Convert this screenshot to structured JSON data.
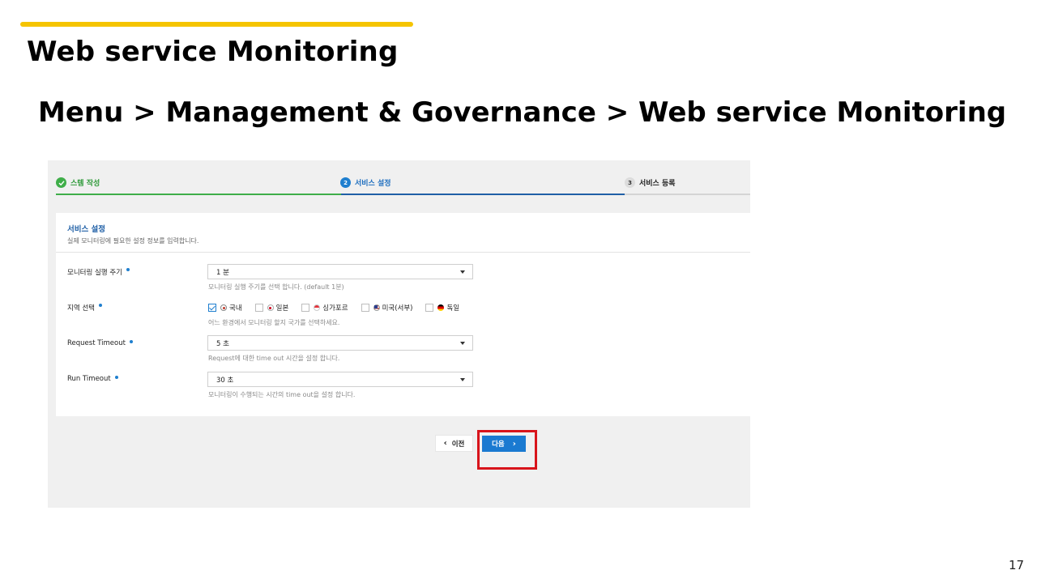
{
  "slide": {
    "title": "Web service Monitoring",
    "breadcrumb": "Menu  >  Management & Governance  >  Web service Monitoring",
    "page_number": "17",
    "accent_color": "#f5c400"
  },
  "stepper": {
    "steps": [
      {
        "number": "",
        "label": "스템 작성",
        "state": "done",
        "icon": "check-icon"
      },
      {
        "number": "2",
        "label": "서비스 설정",
        "state": "active"
      },
      {
        "number": "3",
        "label": "서비스 등록",
        "state": "todo"
      }
    ]
  },
  "form": {
    "title": "서비스 설정",
    "description": "실제 모니터링에 필요한 설정 정보를 입력합니다.",
    "fields": {
      "interval": {
        "label": "모니터링 실행 주기",
        "value": "1 분",
        "hint": "모니터링 실행 주기를 선택 합니다. (default 1분)"
      },
      "region": {
        "label": "지역 선택",
        "hint": "어느 환경에서 모니터링 할지 국가를 선택하세요.",
        "options": [
          {
            "label": "국내",
            "checked": true,
            "flag": "flag-korea-icon"
          },
          {
            "label": "일본",
            "checked": false,
            "flag": "flag-japan-icon"
          },
          {
            "label": "싱가포르",
            "checked": false,
            "flag": "flag-singapore-icon"
          },
          {
            "label": "미국(서부)",
            "checked": false,
            "flag": "flag-usa-icon"
          },
          {
            "label": "독일",
            "checked": false,
            "flag": "flag-germany-icon"
          }
        ]
      },
      "request_timeout": {
        "label": "Request Timeout",
        "value": "5 초",
        "hint": "Request에 대한 time out 시간을 설정 합니다."
      },
      "run_timeout": {
        "label": "Run Timeout",
        "value": "30 초",
        "hint": "모니터링이 수행되는 시간의 time out을 설정 합니다."
      }
    }
  },
  "actions": {
    "prev_label": "이전",
    "next_label": "다음",
    "primary_color": "#1a7ad1",
    "highlight_color": "#d8141b"
  }
}
